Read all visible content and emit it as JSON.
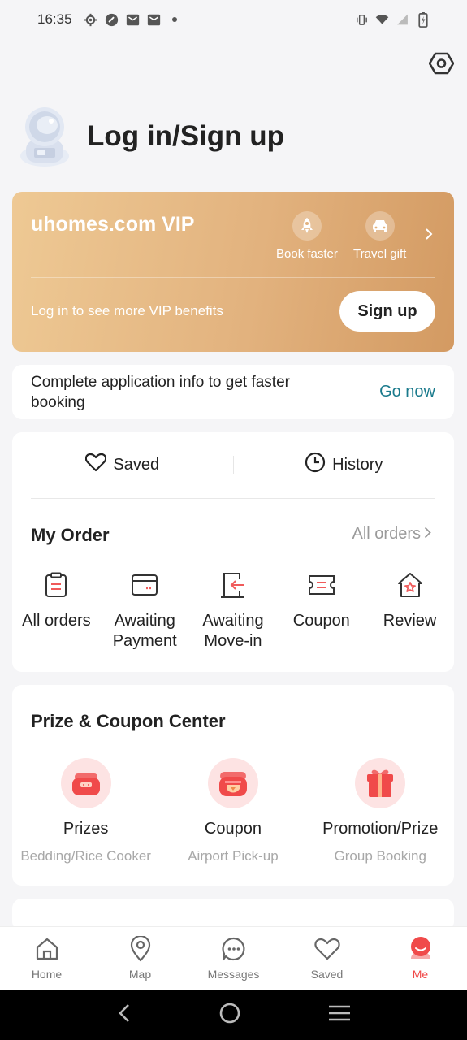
{
  "status_bar": {
    "time": "16:35",
    "left_icons": [
      "settings-icon",
      "app-icon",
      "mail-icon",
      "mail-icon",
      "dot-icon"
    ],
    "right_icons": [
      "vibrate-icon",
      "wifi-icon",
      "signal-icon",
      "battery-icon"
    ]
  },
  "profile": {
    "login_label": "Log in/Sign up"
  },
  "vip": {
    "title": "uhomes.com VIP",
    "benefits": [
      {
        "label": "Book faster",
        "icon": "rocket-icon"
      },
      {
        "label": "Travel gift",
        "icon": "car-icon"
      }
    ],
    "subtitle": "Log in to see more VIP benefits",
    "signup_label": "Sign up",
    "colors": {
      "gradient_start": "#eec994",
      "gradient_end": "#d39a62"
    }
  },
  "application_info": {
    "text": "Complete application info to get faster booking",
    "link_label": "Go now"
  },
  "quick_links": [
    {
      "label": "Saved",
      "icon": "heart-icon"
    },
    {
      "label": "History",
      "icon": "clock-icon"
    }
  ],
  "my_order": {
    "title": "My Order",
    "all_orders_link": "All orders",
    "items": [
      {
        "label": "All orders",
        "icon": "clipboard-icon"
      },
      {
        "label": "Awaiting Payment",
        "icon": "card-icon"
      },
      {
        "label": "Awaiting Move-in",
        "icon": "door-icon"
      },
      {
        "label": "Coupon",
        "icon": "ticket-icon"
      },
      {
        "label": "Review",
        "icon": "house-star-icon"
      }
    ]
  },
  "prize_center": {
    "title": "Prize & Coupon Center",
    "items": [
      {
        "title": "Prizes",
        "subtitle": "Bedding/Rice Cooker",
        "icon": "rice-cooker-icon"
      },
      {
        "title": "Coupon",
        "subtitle": "Airport Pick-up",
        "icon": "coupon-icon"
      },
      {
        "title": "Promotion/Prize",
        "subtitle": "Group Booking",
        "icon": "gift-icon"
      }
    ]
  },
  "tab_bar": {
    "tabs": [
      {
        "label": "Home",
        "icon": "home-icon",
        "active": false
      },
      {
        "label": "Map",
        "icon": "map-pin-icon",
        "active": false
      },
      {
        "label": "Messages",
        "icon": "chat-icon",
        "active": false
      },
      {
        "label": "Saved",
        "icon": "heart-icon",
        "active": false
      },
      {
        "label": "Me",
        "icon": "me-icon",
        "active": true
      }
    ],
    "active_color": "#f04a4a"
  },
  "system_nav": [
    "back-icon",
    "home-circle-icon",
    "recents-icon"
  ]
}
